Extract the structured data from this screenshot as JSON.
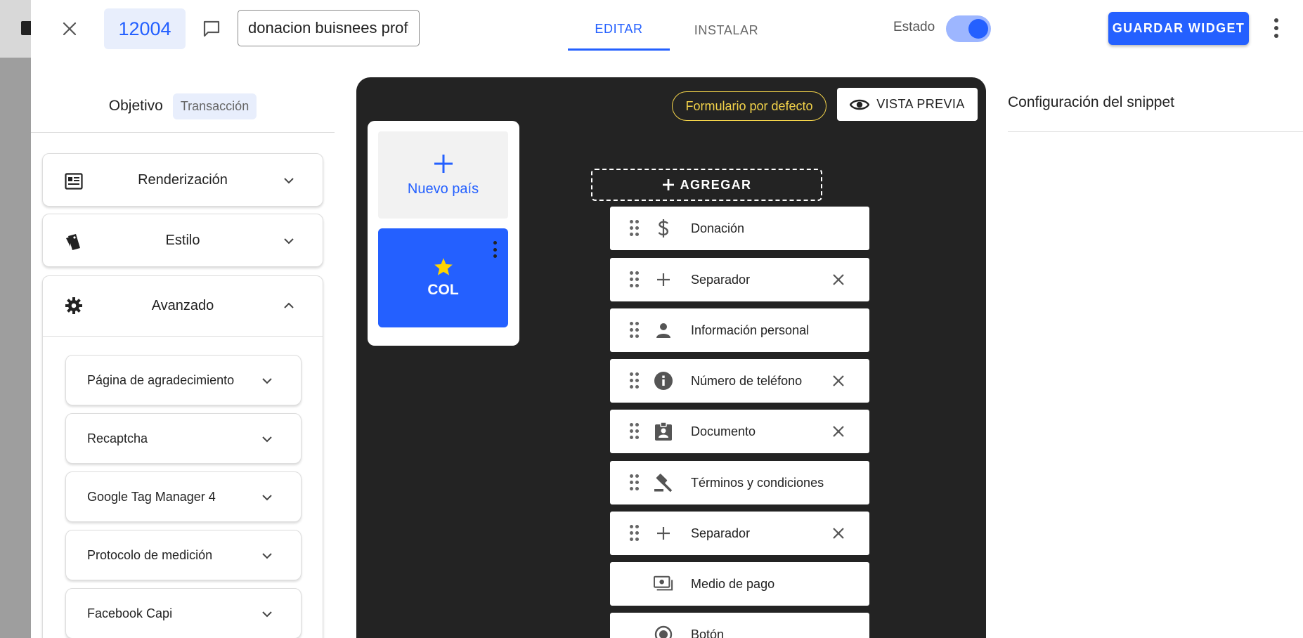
{
  "header": {
    "widget_id": "12004",
    "widget_name": "donacion buisnees profil",
    "tabs": [
      {
        "label": "EDITAR",
        "active": true
      },
      {
        "label": "INSTALAR",
        "active": false
      }
    ],
    "status_label": "Estado",
    "status_on": true,
    "save_label": "GUARDAR WIDGET"
  },
  "left": {
    "objective_label": "Objetivo",
    "objective_value": "Transacción",
    "sections": [
      {
        "label": "Renderización",
        "icon": "article-icon",
        "expanded": false
      },
      {
        "label": "Estilo",
        "icon": "style-icon",
        "expanded": false
      },
      {
        "label": "Avanzado",
        "icon": "gear-icon",
        "expanded": true
      }
    ],
    "advanced_items": [
      "Página de agradecimiento",
      "Recaptcha",
      "Google Tag Manager 4",
      "Protocolo de medición",
      "Facebook Capi"
    ]
  },
  "canvas": {
    "default_form_label": "Formulario por defecto",
    "preview_label": "VISTA PREVIA",
    "new_country_label": "Nuevo país",
    "country_code": "COL",
    "add_label": "AGREGAR",
    "fields": [
      {
        "label": "Donación",
        "icon": "dollar-icon",
        "draggable": true,
        "removable": false
      },
      {
        "label": "Separador",
        "icon": "plus-icon",
        "draggable": true,
        "removable": true
      },
      {
        "label": "Información personal",
        "icon": "person-icon",
        "draggable": true,
        "removable": false
      },
      {
        "label": "Número de teléfono",
        "icon": "info-icon",
        "draggable": true,
        "removable": true
      },
      {
        "label": "Documento",
        "icon": "id-badge-icon",
        "draggable": true,
        "removable": true
      },
      {
        "label": "Términos y condiciones",
        "icon": "gavel-icon",
        "draggable": true,
        "removable": false
      },
      {
        "label": "Separador",
        "icon": "plus-icon",
        "draggable": true,
        "removable": true
      },
      {
        "label": "Medio de pago",
        "icon": "payments-icon",
        "draggable": false,
        "removable": false
      },
      {
        "label": "Botón",
        "icon": "radio-button-icon",
        "draggable": false,
        "removable": false
      }
    ]
  },
  "right": {
    "title": "Configuración del snippet"
  },
  "colors": {
    "primary": "#2460ff",
    "canvas_bg": "#232323",
    "chip_bg": "#e8eefc",
    "default_form_yellow": "#f3d34a",
    "star_yellow": "#ffd400"
  }
}
